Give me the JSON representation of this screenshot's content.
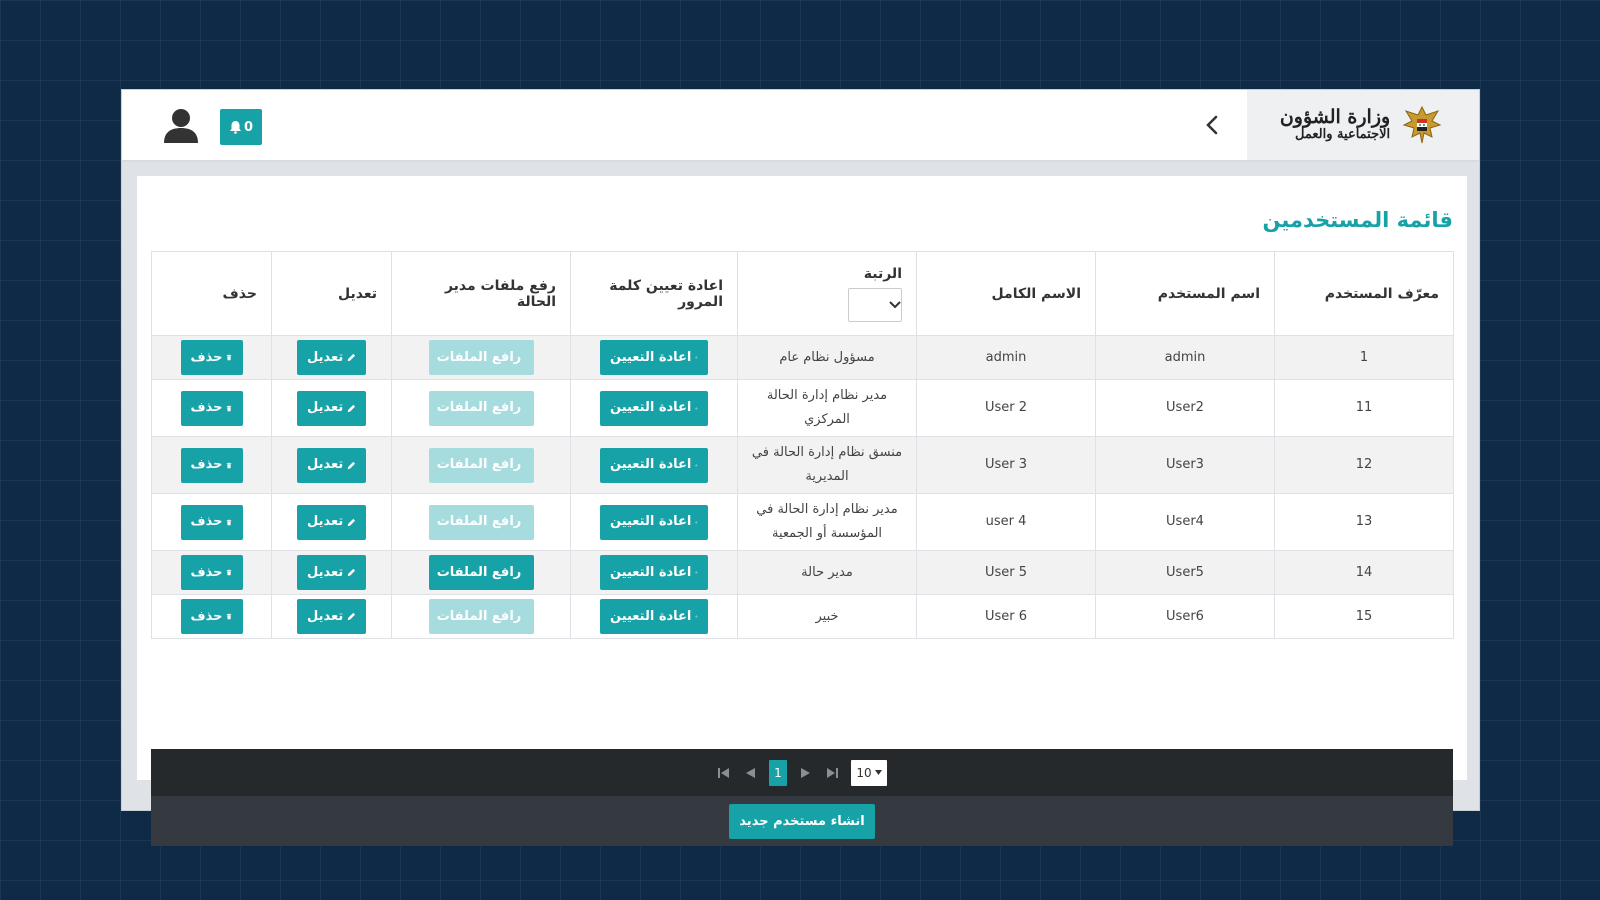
{
  "header": {
    "brand_line1": "وزارة الشؤون",
    "brand_line2": "الاجتماعية والعمل",
    "notifications_count": "0"
  },
  "page": {
    "title": "قائمة المستخدمين"
  },
  "table": {
    "headers": {
      "id": "معرّف المستخدم",
      "username": "اسم المستخدم",
      "fullname": "الاسم الكامل",
      "rank": "الرتبة",
      "reset": "اعادة تعيين كلمة المرور",
      "upload": "رفع ملفات مدير الحالة",
      "edit": "تعديل",
      "delete": "حذف"
    },
    "rows": [
      {
        "id": "1",
        "username": "admin",
        "fullname": "admin",
        "rank": "مسؤول نظام عام",
        "upload_enabled": false
      },
      {
        "id": "11",
        "username": "User2",
        "fullname": "User 2",
        "rank": "مدير نظام إدارة الحالة المركزي",
        "upload_enabled": false
      },
      {
        "id": "12",
        "username": "User3",
        "fullname": "User 3",
        "rank": "منسق نظام إدارة الحالة في المديرية",
        "upload_enabled": false
      },
      {
        "id": "13",
        "username": "User4",
        "fullname": "user 4",
        "rank": "مدير نظام إدارة الحالة في المؤسسة أو الجمعية",
        "upload_enabled": false
      },
      {
        "id": "14",
        "username": "User5",
        "fullname": "User 5",
        "rank": "مدير حالة",
        "upload_enabled": true
      },
      {
        "id": "15",
        "username": "User6",
        "fullname": "User 6",
        "rank": "خبير",
        "upload_enabled": false
      }
    ]
  },
  "buttons": {
    "reset_label": "اعادة التعيين",
    "upload_label": "رافع الملفات",
    "edit_label": "تعديل",
    "delete_label": "حذف",
    "create_user_label": "انشاء مستخدم جديد"
  },
  "pagination": {
    "current_page": "1",
    "page_size": "10"
  },
  "icons": {
    "reset": "gear-icon",
    "upload": "cloud-upload-icon",
    "edit": "pencil-icon",
    "delete": "trash-icon"
  },
  "colors": {
    "accent": "#17a2a8",
    "accent_disabled": "#a6dcde",
    "dark_bar": "#25292c"
  }
}
